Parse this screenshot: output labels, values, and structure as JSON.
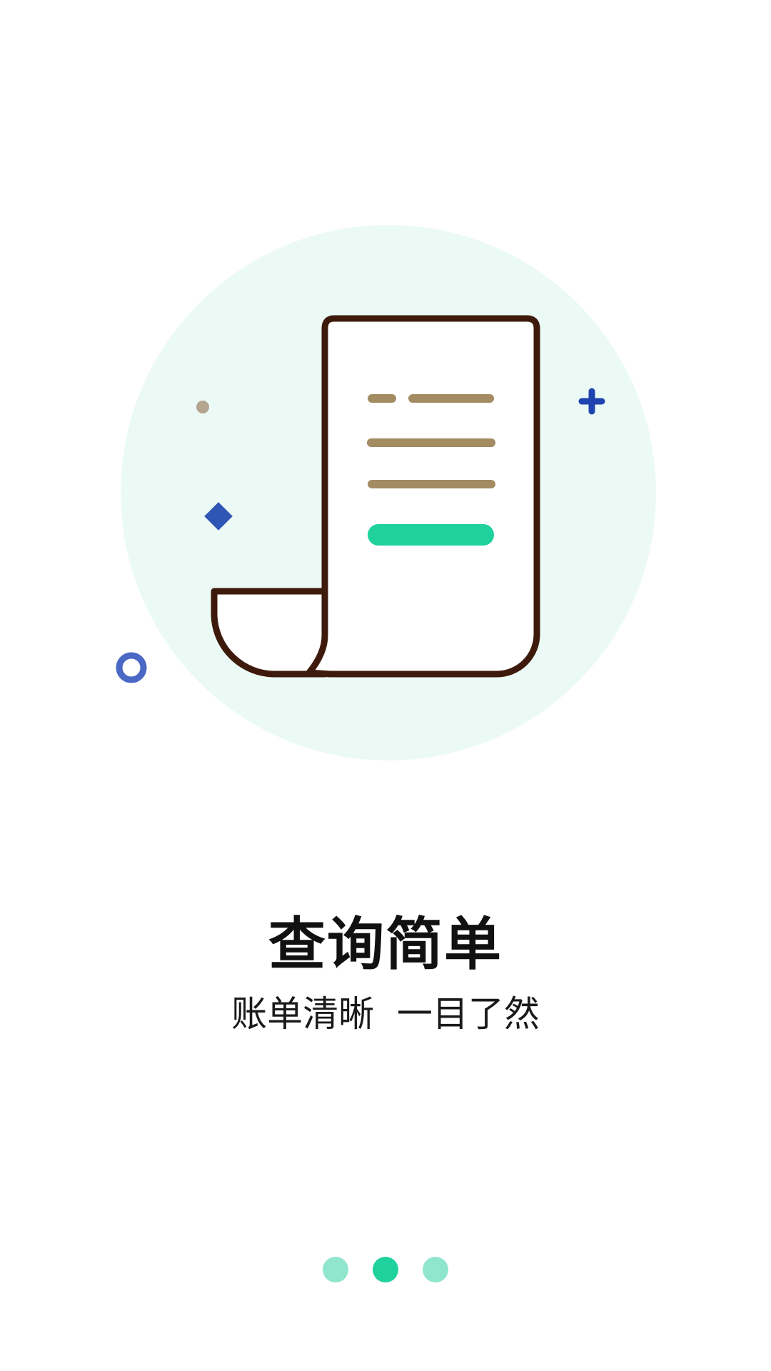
{
  "intro": {
    "title": "查询简单",
    "subtitle": "账单清晰  一目了然"
  },
  "pager": {
    "count": 3,
    "active_index": 1
  },
  "colors": {
    "circle_bg": "#ecfaf6",
    "doc_outline": "#3d1a0b",
    "doc_lines": "#a38b62",
    "accent_green": "#1fd19d",
    "dot_inactive": "#8fe6cd",
    "dot_active": "#1fd19d",
    "blue_shape": "#2f55b5",
    "gray_dot": "#b3a58f"
  }
}
